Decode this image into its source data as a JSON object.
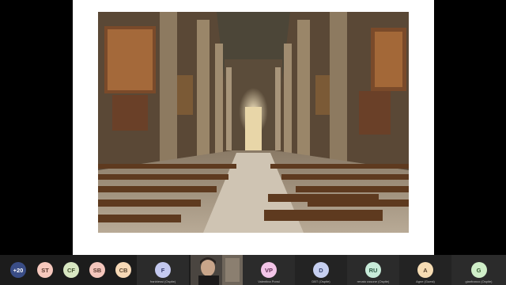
{
  "presentation": {
    "image_alt": "Cathedral interior photograph"
  },
  "participants": [
    {
      "initials": "+20",
      "name": "",
      "color": "#3a4d86",
      "text_color": "#ffffff"
    },
    {
      "initials": "ST",
      "name": "",
      "color": "#f6c8bd",
      "text_color": "#5a3a30"
    },
    {
      "initials": "CF",
      "name": "",
      "color": "#d8e7c2",
      "text_color": "#44512f"
    },
    {
      "initials": "SB",
      "name": "",
      "color": "#f4c6bc",
      "text_color": "#5a3a30"
    },
    {
      "initials": "CB",
      "name": "",
      "color": "#f7d9b6",
      "text_color": "#5a4630"
    },
    {
      "initials": "F",
      "name": "franbiessi (Ospite)",
      "color": "#c3c8ef",
      "text_color": "#34396a"
    },
    {
      "initials": "VP",
      "name": "Valentina Ponsi",
      "color": "#f3c5e8",
      "text_color": "#5e2f52"
    },
    {
      "initials": "D",
      "name": "DBT (Ospite)",
      "color": "#c6cff0",
      "text_color": "#33406a"
    },
    {
      "initials": "RU",
      "name": "renato ussone (Ospite)",
      "color": "#c7ebd9",
      "text_color": "#2e5a45"
    },
    {
      "initials": "A",
      "name": "Agne (Guest)",
      "color": "#f6dcb3",
      "text_color": "#5a4630"
    },
    {
      "initials": "G",
      "name": "gianfranco (Ospite)",
      "color": "#cfeec8",
      "text_color": "#345a30"
    }
  ],
  "video_participant": {
    "name": ""
  }
}
